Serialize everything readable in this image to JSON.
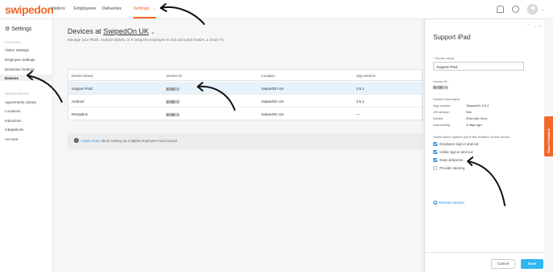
{
  "app": {
    "logo": "swipedon"
  },
  "nav": {
    "items": [
      {
        "label": "Visitors"
      },
      {
        "label": "Employees"
      },
      {
        "label": "Deliveries"
      },
      {
        "label": "Settings"
      }
    ]
  },
  "sidebar": {
    "title": "Settings",
    "location_section": "LOCATION",
    "location_items": [
      {
        "label": "Visitor Settings"
      },
      {
        "label": "Employee Settings"
      },
      {
        "label": "Deliveries Settings"
      },
      {
        "label": "Devices"
      }
    ],
    "organization_section": "ORGANIZATION",
    "organization_items": [
      {
        "label": "Agreements Library"
      },
      {
        "label": "Locations"
      },
      {
        "label": "Inductions"
      },
      {
        "label": "Integrations"
      },
      {
        "label": "Account"
      }
    ]
  },
  "main": {
    "title_prefix": "Devices at",
    "location": "SwipedOn UK",
    "subtitle": "Manage your iPads, Android tablets, or if using the employee in and out board feature, a smart TV",
    "table": {
      "headers": [
        "Device Name",
        "Device ID",
        "Location",
        "App Version"
      ],
      "rows": [
        {
          "name": "Support iPad",
          "location": "SwipedOn UK",
          "version": "3.5.2"
        },
        {
          "name": "Android",
          "location": "SwipedOn UK",
          "version": "3.5.2"
        },
        {
          "name": "Reception",
          "location": "SwipedOn UK",
          "version": "—"
        }
      ]
    },
    "info": {
      "link": "Learn more",
      "text": "about setting up a digital employee in/out board"
    }
  },
  "panel": {
    "title": "Support iPad",
    "device_name_label": "* Device name",
    "device_name_value": "Support iPad",
    "device_id_label": "Device ID",
    "device_info_label": "Device Information",
    "info": [
      {
        "key": "App version",
        "value": "SwipedOn 3.5.2"
      },
      {
        "key": "OS version",
        "value": "N/A"
      },
      {
        "key": "Device",
        "value": "iPad (6th Gen)"
      },
      {
        "key": "Last activity",
        "value": "3 days ago"
      }
    ],
    "options_label": "Select which options you'd like enabled on this device",
    "options": [
      {
        "label": "Employee sign in and out",
        "checked": true
      },
      {
        "label": "Visitor sign in and out",
        "checked": true
      },
      {
        "label": "Scan deliveries",
        "checked": true
      },
      {
        "label": "Provide catering",
        "checked": false
      }
    ],
    "remove_label": "Remove Device",
    "cancel_label": "Cancel",
    "save_label": "Save"
  },
  "feedback": {
    "label": "Share Feedback"
  },
  "colors": {
    "brand": "#f2672a",
    "primary": "#2e8ed6",
    "save": "#2fb5f0"
  }
}
